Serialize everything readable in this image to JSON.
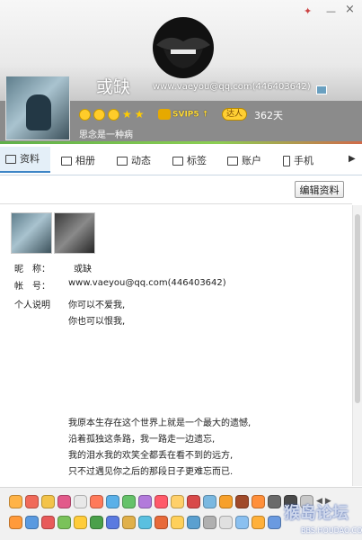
{
  "window": {
    "close_glyph": "×",
    "min_glyph": "—",
    "skin_glyph": "✦"
  },
  "header": {
    "nickname": "或缺",
    "email": "www.vaeyou@qq.com(446403642)",
    "svip": "SVIP5",
    "svip_arrow": "↑",
    "daren_badge": "达人",
    "days": "362天",
    "signature": "思念是一种病",
    "icons": [
      "avatar",
      "lips-image",
      "smile-icon",
      "smile-icon",
      "smile-icon",
      "star-icon",
      "star-icon",
      "svip-crown-icon",
      "daren-icon"
    ]
  },
  "tabs": [
    {
      "label": "资料",
      "icon": "profile-card-icon",
      "active": true
    },
    {
      "label": "相册",
      "icon": "photo-icon",
      "active": false
    },
    {
      "label": "动态",
      "icon": "grid-icon",
      "active": false
    },
    {
      "label": "标签",
      "icon": "bookmark-icon",
      "active": false
    },
    {
      "label": "账户",
      "icon": "wallet-icon",
      "active": false
    },
    {
      "label": "手机",
      "icon": "phone-icon",
      "active": false
    }
  ],
  "tabs_more": "▶",
  "toolbar": {
    "edit_label": "编辑资料"
  },
  "profile": {
    "nickname_label": "昵　称：",
    "nickname_value": "或缺",
    "account_label": "帐　号：",
    "account_value": "www.vaeyou@qq.com(446403642)",
    "bio_label": "个人说明",
    "bio_lines_a": [
      "你可以不爱我,",
      "你也可以恨我,"
    ],
    "bio_lines_b": [
      "我原本生存在这个世界上就是一个最大的遗憾,",
      "沿着孤独这条路，我一路走一边遗忘,",
      "我的泪水我的欢笑全都丢在看不到的远方,",
      "只不过遇见你之后的那段日子更难忘而已."
    ]
  },
  "emoticon_arrows": {
    "left": "◀",
    "right": "▶"
  },
  "watermark": {
    "main": "猴岛论坛",
    "sub": "BBS.HOUDAO.COM"
  }
}
